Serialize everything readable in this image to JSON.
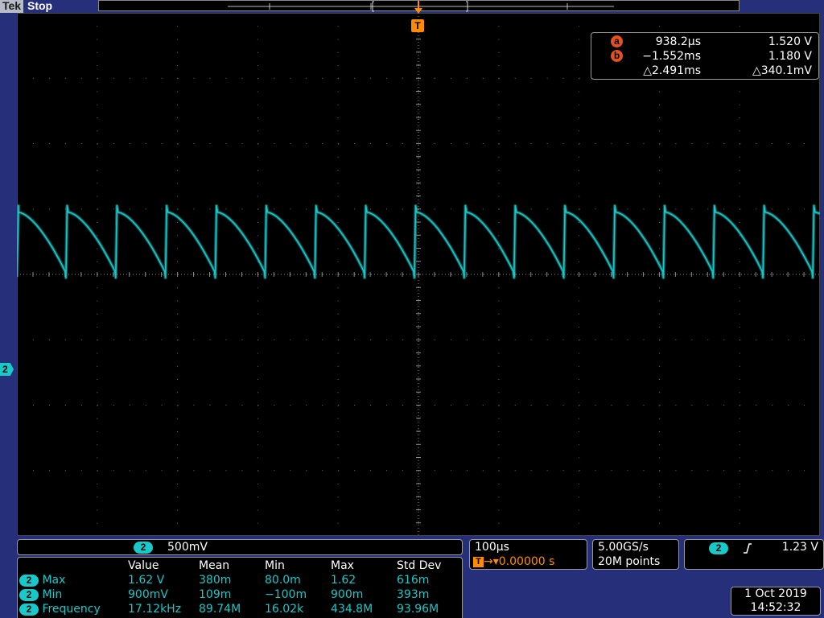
{
  "header": {
    "brand": "Tek",
    "acquisition_state": "Stop"
  },
  "trigger_marker": {
    "label": "T"
  },
  "cursor_readout": {
    "a": {
      "label": "a",
      "time": "938.2µs",
      "voltage": "1.520 V"
    },
    "b": {
      "label": "b",
      "time": "−1.552ms",
      "voltage": "1.180 V"
    },
    "delta": {
      "time": "△2.491ms",
      "voltage": "△340.1mV"
    }
  },
  "channel_marker": {
    "label": "2"
  },
  "waveform": {
    "color": "#19c8c8",
    "cycles_visible": 16,
    "period_div": 0.62,
    "high_level_div": -0.95,
    "low_level_div": 0.05,
    "spike_level_div": -1.05
  },
  "vertical": {
    "channel": "2",
    "scale": "500mV"
  },
  "measurements": {
    "headers": [
      "Value",
      "Mean",
      "Min",
      "Max",
      "Std Dev"
    ],
    "rows": [
      {
        "channel": "2",
        "name": "Max",
        "value": "1.62 V",
        "mean": "380m",
        "min": "80.0m",
        "max": "1.62",
        "std_dev": "616m"
      },
      {
        "channel": "2",
        "name": "Min",
        "value": "900mV",
        "mean": "109m",
        "min": "−100m",
        "max": "900m",
        "std_dev": "393m"
      },
      {
        "channel": "2",
        "name": "Frequency",
        "value": "17.12kHz",
        "mean": "89.74M",
        "min": "16.02k",
        "max": "434.8M",
        "std_dev": "93.96M"
      }
    ]
  },
  "horizontal": {
    "scale": "100µs",
    "trigger_label": "T",
    "delay": "0.00000 s"
  },
  "acquisition": {
    "sample_rate": "5.00GS/s",
    "record_length": "20M points"
  },
  "trigger": {
    "channel": "2",
    "slope_icon": "rising-edge-icon",
    "level": "1.23 V"
  },
  "datetime": {
    "date": "1 Oct  2019",
    "time": "14:52:32"
  },
  "colors": {
    "channel2": "#19c8c8",
    "trigger": "#ff8c00",
    "cursor": "#e8501f",
    "background": "#26307a",
    "graticule": "#000000"
  }
}
